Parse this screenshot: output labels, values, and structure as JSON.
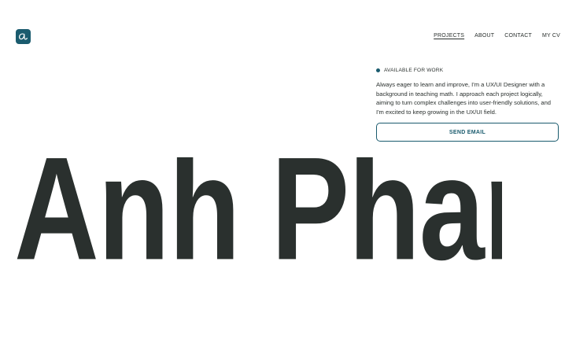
{
  "brand": {
    "logo_icon": "signature-logo-icon",
    "accent_color": "#1a5b6e"
  },
  "nav": {
    "items": [
      {
        "label": "PROJECTS",
        "active": true
      },
      {
        "label": "ABOUT",
        "active": false
      },
      {
        "label": "CONTACT",
        "active": false
      },
      {
        "label": "MY CV",
        "active": false
      }
    ]
  },
  "status": {
    "label": "AVAILABLE FOR WORK",
    "dot_color": "#1a5b6e"
  },
  "intro": {
    "text": "Always eager to learn and improve, I'm a UX/UI Designer with a background in teaching math. I approach each project logically, aiming to turn complex challenges into user-friendly solutions, and I'm excited to keep growing in the UX/UI field."
  },
  "cta": {
    "email_label": "SEND EMAIL"
  },
  "hero": {
    "name": "Anh Pham",
    "text_color": "#2a302e"
  }
}
